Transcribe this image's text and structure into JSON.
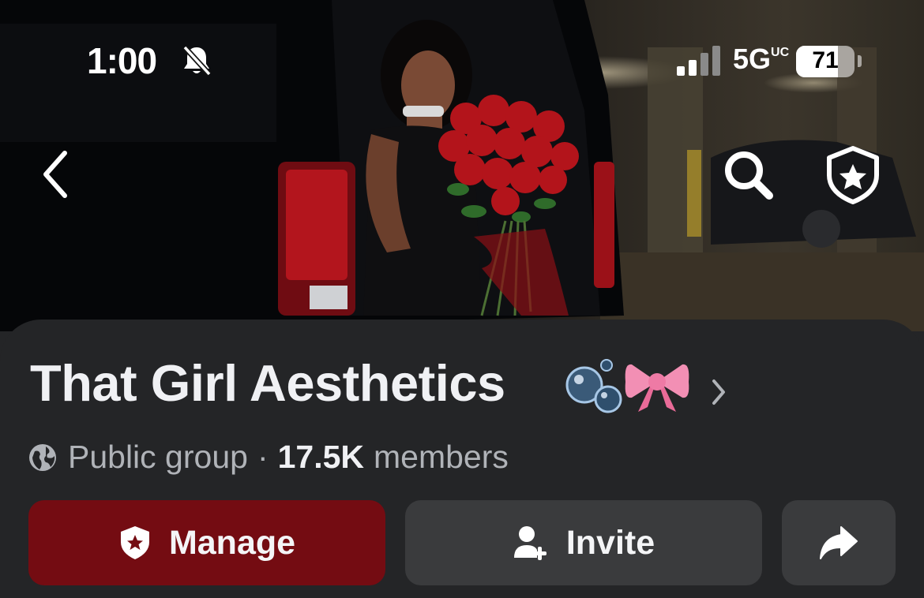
{
  "status_bar": {
    "time": "1:00",
    "network": "5G",
    "network_superscript": "UC",
    "battery": "71",
    "battery_level": 0.71,
    "icons": [
      "bell-slash-icon",
      "signal-icon",
      "battery-icon"
    ]
  },
  "nav": {
    "icons": [
      "chevron-left-icon",
      "search-icon",
      "shield-star-icon"
    ]
  },
  "group": {
    "name": "That Girl Aesthetics",
    "name_emoji": [
      "bubbles-emoji",
      "ribbon-bow-emoji"
    ],
    "privacy": "Public group",
    "separator": "·",
    "member_count": "17.5K",
    "member_label": "members"
  },
  "actions": {
    "manage_label": "Manage",
    "invite_label": "Invite",
    "icons": [
      "shield-star-icon",
      "add-person-icon",
      "share-arrow-icon"
    ]
  },
  "colors": {
    "background": "#242527",
    "manage_button": "#740c12",
    "secondary_button": "#3a3b3d",
    "text_primary": "#f0f1f4",
    "text_secondary": "#b0b3b8"
  }
}
